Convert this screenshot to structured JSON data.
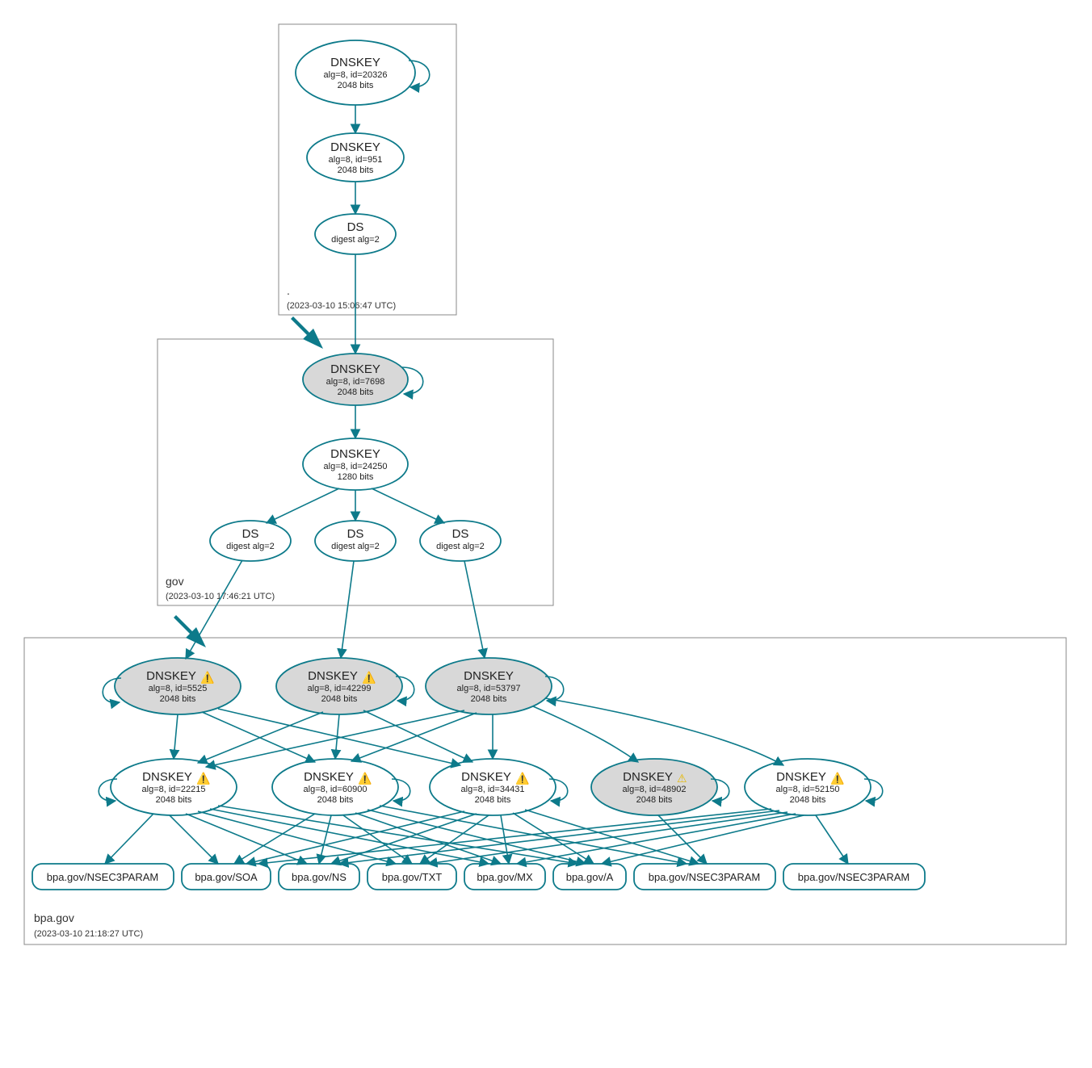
{
  "zones": {
    "root": {
      "name": ".",
      "timestamp": "(2023-03-10 15:06:47 UTC)"
    },
    "gov": {
      "name": "gov",
      "timestamp": "(2023-03-10 17:46:21 UTC)"
    },
    "bpa": {
      "name": "bpa.gov",
      "timestamp": "(2023-03-10 21:18:27 UTC)"
    }
  },
  "nodes": {
    "root_ksk": {
      "title": "DNSKEY",
      "line2": "alg=8, id=20326",
      "line3": "2048 bits"
    },
    "root_zsk": {
      "title": "DNSKEY",
      "line2": "alg=8, id=951",
      "line3": "2048 bits"
    },
    "root_ds": {
      "title": "DS",
      "line2": "digest alg=2"
    },
    "gov_ksk": {
      "title": "DNSKEY",
      "line2": "alg=8, id=7698",
      "line3": "2048 bits"
    },
    "gov_zsk": {
      "title": "DNSKEY",
      "line2": "alg=8, id=24250",
      "line3": "1280 bits"
    },
    "gov_ds1": {
      "title": "DS",
      "line2": "digest alg=2"
    },
    "gov_ds2": {
      "title": "DS",
      "line2": "digest alg=2"
    },
    "gov_ds3": {
      "title": "DS",
      "line2": "digest alg=2"
    },
    "bpa_k5525": {
      "title": "DNSKEY",
      "line2": "alg=8, id=5525",
      "line3": "2048 bits",
      "icon": "error"
    },
    "bpa_k42299": {
      "title": "DNSKEY",
      "line2": "alg=8, id=42299",
      "line3": "2048 bits",
      "icon": "error"
    },
    "bpa_k53797": {
      "title": "DNSKEY",
      "line2": "alg=8, id=53797",
      "line3": "2048 bits"
    },
    "bpa_k22215": {
      "title": "DNSKEY",
      "line2": "alg=8, id=22215",
      "line3": "2048 bits",
      "icon": "error"
    },
    "bpa_k60900": {
      "title": "DNSKEY",
      "line2": "alg=8, id=60900",
      "line3": "2048 bits",
      "icon": "error"
    },
    "bpa_k34431": {
      "title": "DNSKEY",
      "line2": "alg=8, id=34431",
      "line3": "2048 bits",
      "icon": "error"
    },
    "bpa_k48902": {
      "title": "DNSKEY",
      "line2": "alg=8, id=48902",
      "line3": "2048 bits",
      "icon": "warn"
    },
    "bpa_k52150": {
      "title": "DNSKEY",
      "line2": "alg=8, id=52150",
      "line3": "2048 bits",
      "icon": "error"
    }
  },
  "leaves": {
    "l1": "bpa.gov/NSEC3PARAM",
    "l2": "bpa.gov/SOA",
    "l3": "bpa.gov/NS",
    "l4": "bpa.gov/TXT",
    "l5": "bpa.gov/MX",
    "l6": "bpa.gov/A",
    "l7": "bpa.gov/NSEC3PARAM",
    "l8": "bpa.gov/NSEC3PARAM"
  },
  "chart_data": {
    "type": "graph",
    "description": "DNSSEC authentication chain / DNSViz-style delegation graph",
    "zones": [
      {
        "name": ".",
        "timestamp": "2023-03-10 15:06:47 UTC"
      },
      {
        "name": "gov",
        "timestamp": "2023-03-10 17:46:21 UTC"
      },
      {
        "name": "bpa.gov",
        "timestamp": "2023-03-10 21:18:27 UTC"
      }
    ],
    "nodes": [
      {
        "id": "root_ksk",
        "zone": ".",
        "type": "DNSKEY",
        "alg": 8,
        "key_id": 20326,
        "bits": 2048,
        "trust_anchor": true
      },
      {
        "id": "root_zsk",
        "zone": ".",
        "type": "DNSKEY",
        "alg": 8,
        "key_id": 951,
        "bits": 2048
      },
      {
        "id": "root_ds",
        "zone": ".",
        "type": "DS",
        "digest_alg": 2
      },
      {
        "id": "gov_ksk",
        "zone": "gov",
        "type": "DNSKEY",
        "alg": 8,
        "key_id": 7698,
        "bits": 2048,
        "sep": true
      },
      {
        "id": "gov_zsk",
        "zone": "gov",
        "type": "DNSKEY",
        "alg": 8,
        "key_id": 24250,
        "bits": 1280
      },
      {
        "id": "gov_ds1",
        "zone": "gov",
        "type": "DS",
        "digest_alg": 2
      },
      {
        "id": "gov_ds2",
        "zone": "gov",
        "type": "DS",
        "digest_alg": 2
      },
      {
        "id": "gov_ds3",
        "zone": "gov",
        "type": "DS",
        "digest_alg": 2
      },
      {
        "id": "bpa_k5525",
        "zone": "bpa.gov",
        "type": "DNSKEY",
        "alg": 8,
        "key_id": 5525,
        "bits": 2048,
        "sep": true,
        "status": "error"
      },
      {
        "id": "bpa_k42299",
        "zone": "bpa.gov",
        "type": "DNSKEY",
        "alg": 8,
        "key_id": 42299,
        "bits": 2048,
        "sep": true,
        "status": "error"
      },
      {
        "id": "bpa_k53797",
        "zone": "bpa.gov",
        "type": "DNSKEY",
        "alg": 8,
        "key_id": 53797,
        "bits": 2048,
        "sep": true
      },
      {
        "id": "bpa_k22215",
        "zone": "bpa.gov",
        "type": "DNSKEY",
        "alg": 8,
        "key_id": 22215,
        "bits": 2048,
        "status": "error"
      },
      {
        "id": "bpa_k60900",
        "zone": "bpa.gov",
        "type": "DNSKEY",
        "alg": 8,
        "key_id": 60900,
        "bits": 2048,
        "status": "error"
      },
      {
        "id": "bpa_k34431",
        "zone": "bpa.gov",
        "type": "DNSKEY",
        "alg": 8,
        "key_id": 34431,
        "bits": 2048,
        "status": "error"
      },
      {
        "id": "bpa_k48902",
        "zone": "bpa.gov",
        "type": "DNSKEY",
        "alg": 8,
        "key_id": 48902,
        "bits": 2048,
        "sep": true,
        "status": "warning"
      },
      {
        "id": "bpa_k52150",
        "zone": "bpa.gov",
        "type": "DNSKEY",
        "alg": 8,
        "key_id": 52150,
        "bits": 2048,
        "status": "error"
      },
      {
        "id": "rr_nsec3_a",
        "zone": "bpa.gov",
        "type": "RRset",
        "name": "bpa.gov/NSEC3PARAM"
      },
      {
        "id": "rr_soa",
        "zone": "bpa.gov",
        "type": "RRset",
        "name": "bpa.gov/SOA"
      },
      {
        "id": "rr_ns",
        "zone": "bpa.gov",
        "type": "RRset",
        "name": "bpa.gov/NS"
      },
      {
        "id": "rr_txt",
        "zone": "bpa.gov",
        "type": "RRset",
        "name": "bpa.gov/TXT"
      },
      {
        "id": "rr_mx",
        "zone": "bpa.gov",
        "type": "RRset",
        "name": "bpa.gov/MX"
      },
      {
        "id": "rr_a",
        "zone": "bpa.gov",
        "type": "RRset",
        "name": "bpa.gov/A"
      },
      {
        "id": "rr_nsec3_b",
        "zone": "bpa.gov",
        "type": "RRset",
        "name": "bpa.gov/NSEC3PARAM"
      },
      {
        "id": "rr_nsec3_c",
        "zone": "bpa.gov",
        "type": "RRset",
        "name": "bpa.gov/NSEC3PARAM"
      }
    ],
    "edges": [
      [
        "root_ksk",
        "root_ksk"
      ],
      [
        "root_ksk",
        "root_zsk"
      ],
      [
        "root_zsk",
        "root_ds"
      ],
      [
        "root_ds",
        "gov_ksk"
      ],
      [
        "gov_ksk",
        "gov_ksk"
      ],
      [
        "gov_ksk",
        "gov_zsk"
      ],
      [
        "gov_zsk",
        "gov_ds1"
      ],
      [
        "gov_zsk",
        "gov_ds2"
      ],
      [
        "gov_zsk",
        "gov_ds3"
      ],
      [
        "gov_ds1",
        "bpa_k5525"
      ],
      [
        "gov_ds2",
        "bpa_k42299"
      ],
      [
        "gov_ds3",
        "bpa_k53797"
      ],
      [
        "bpa_k5525",
        "bpa_k5525"
      ],
      [
        "bpa_k42299",
        "bpa_k42299"
      ],
      [
        "bpa_k53797",
        "bpa_k53797"
      ],
      [
        "bpa_k5525",
        "bpa_k22215"
      ],
      [
        "bpa_k42299",
        "bpa_k22215"
      ],
      [
        "bpa_k53797",
        "bpa_k22215"
      ],
      [
        "bpa_k5525",
        "bpa_k60900"
      ],
      [
        "bpa_k42299",
        "bpa_k60900"
      ],
      [
        "bpa_k53797",
        "bpa_k60900"
      ],
      [
        "bpa_k5525",
        "bpa_k34431"
      ],
      [
        "bpa_k42299",
        "bpa_k34431"
      ],
      [
        "bpa_k53797",
        "bpa_k34431"
      ],
      [
        "bpa_k53797",
        "bpa_k48902"
      ],
      [
        "bpa_k53797",
        "bpa_k52150"
      ],
      [
        "bpa_k22215",
        "bpa_k22215"
      ],
      [
        "bpa_k60900",
        "bpa_k60900"
      ],
      [
        "bpa_k34431",
        "bpa_k34431"
      ],
      [
        "bpa_k48902",
        "bpa_k48902"
      ],
      [
        "bpa_k52150",
        "bpa_k52150"
      ],
      [
        "bpa_k22215",
        "rr_nsec3_a"
      ],
      [
        "bpa_k22215",
        "rr_soa"
      ],
      [
        "bpa_k22215",
        "rr_ns"
      ],
      [
        "bpa_k22215",
        "rr_txt"
      ],
      [
        "bpa_k22215",
        "rr_mx"
      ],
      [
        "bpa_k22215",
        "rr_a"
      ],
      [
        "bpa_k60900",
        "rr_soa"
      ],
      [
        "bpa_k60900",
        "rr_ns"
      ],
      [
        "bpa_k60900",
        "rr_txt"
      ],
      [
        "bpa_k60900",
        "rr_mx"
      ],
      [
        "bpa_k60900",
        "rr_a"
      ],
      [
        "bpa_k60900",
        "rr_nsec3_b"
      ],
      [
        "bpa_k34431",
        "rr_soa"
      ],
      [
        "bpa_k34431",
        "rr_ns"
      ],
      [
        "bpa_k34431",
        "rr_txt"
      ],
      [
        "bpa_k34431",
        "rr_mx"
      ],
      [
        "bpa_k34431",
        "rr_a"
      ],
      [
        "bpa_k34431",
        "rr_nsec3_b"
      ],
      [
        "bpa_k48902",
        "rr_nsec3_b"
      ],
      [
        "bpa_k52150",
        "rr_soa"
      ],
      [
        "bpa_k52150",
        "rr_ns"
      ],
      [
        "bpa_k52150",
        "rr_txt"
      ],
      [
        "bpa_k52150",
        "rr_mx"
      ],
      [
        "bpa_k52150",
        "rr_a"
      ],
      [
        "bpa_k52150",
        "rr_nsec3_c"
      ]
    ]
  }
}
